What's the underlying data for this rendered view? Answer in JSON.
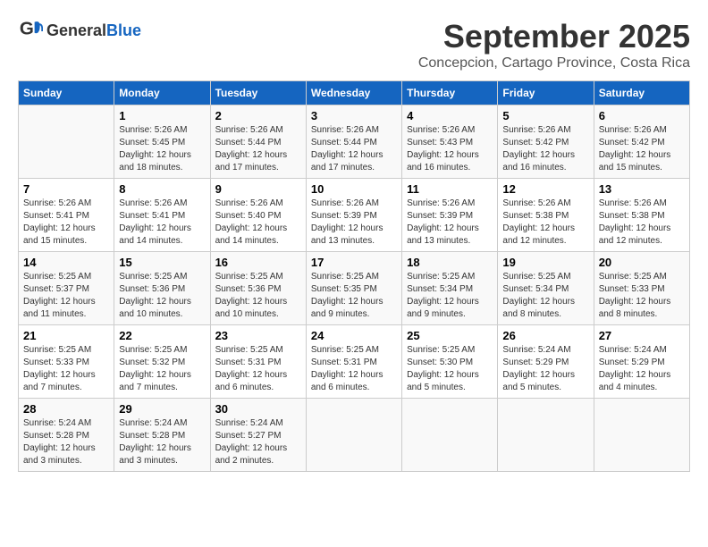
{
  "logo": {
    "general": "General",
    "blue": "Blue"
  },
  "title": "September 2025",
  "location": "Concepcion, Cartago Province, Costa Rica",
  "days_of_week": [
    "Sunday",
    "Monday",
    "Tuesday",
    "Wednesday",
    "Thursday",
    "Friday",
    "Saturday"
  ],
  "weeks": [
    [
      {
        "day": "",
        "info": ""
      },
      {
        "day": "1",
        "info": "Sunrise: 5:26 AM\nSunset: 5:45 PM\nDaylight: 12 hours\nand 18 minutes."
      },
      {
        "day": "2",
        "info": "Sunrise: 5:26 AM\nSunset: 5:44 PM\nDaylight: 12 hours\nand 17 minutes."
      },
      {
        "day": "3",
        "info": "Sunrise: 5:26 AM\nSunset: 5:44 PM\nDaylight: 12 hours\nand 17 minutes."
      },
      {
        "day": "4",
        "info": "Sunrise: 5:26 AM\nSunset: 5:43 PM\nDaylight: 12 hours\nand 16 minutes."
      },
      {
        "day": "5",
        "info": "Sunrise: 5:26 AM\nSunset: 5:42 PM\nDaylight: 12 hours\nand 16 minutes."
      },
      {
        "day": "6",
        "info": "Sunrise: 5:26 AM\nSunset: 5:42 PM\nDaylight: 12 hours\nand 15 minutes."
      }
    ],
    [
      {
        "day": "7",
        "info": "Sunrise: 5:26 AM\nSunset: 5:41 PM\nDaylight: 12 hours\nand 15 minutes."
      },
      {
        "day": "8",
        "info": "Sunrise: 5:26 AM\nSunset: 5:41 PM\nDaylight: 12 hours\nand 14 minutes."
      },
      {
        "day": "9",
        "info": "Sunrise: 5:26 AM\nSunset: 5:40 PM\nDaylight: 12 hours\nand 14 minutes."
      },
      {
        "day": "10",
        "info": "Sunrise: 5:26 AM\nSunset: 5:39 PM\nDaylight: 12 hours\nand 13 minutes."
      },
      {
        "day": "11",
        "info": "Sunrise: 5:26 AM\nSunset: 5:39 PM\nDaylight: 12 hours\nand 13 minutes."
      },
      {
        "day": "12",
        "info": "Sunrise: 5:26 AM\nSunset: 5:38 PM\nDaylight: 12 hours\nand 12 minutes."
      },
      {
        "day": "13",
        "info": "Sunrise: 5:26 AM\nSunset: 5:38 PM\nDaylight: 12 hours\nand 12 minutes."
      }
    ],
    [
      {
        "day": "14",
        "info": "Sunrise: 5:25 AM\nSunset: 5:37 PM\nDaylight: 12 hours\nand 11 minutes."
      },
      {
        "day": "15",
        "info": "Sunrise: 5:25 AM\nSunset: 5:36 PM\nDaylight: 12 hours\nand 10 minutes."
      },
      {
        "day": "16",
        "info": "Sunrise: 5:25 AM\nSunset: 5:36 PM\nDaylight: 12 hours\nand 10 minutes."
      },
      {
        "day": "17",
        "info": "Sunrise: 5:25 AM\nSunset: 5:35 PM\nDaylight: 12 hours\nand 9 minutes."
      },
      {
        "day": "18",
        "info": "Sunrise: 5:25 AM\nSunset: 5:34 PM\nDaylight: 12 hours\nand 9 minutes."
      },
      {
        "day": "19",
        "info": "Sunrise: 5:25 AM\nSunset: 5:34 PM\nDaylight: 12 hours\nand 8 minutes."
      },
      {
        "day": "20",
        "info": "Sunrise: 5:25 AM\nSunset: 5:33 PM\nDaylight: 12 hours\nand 8 minutes."
      }
    ],
    [
      {
        "day": "21",
        "info": "Sunrise: 5:25 AM\nSunset: 5:33 PM\nDaylight: 12 hours\nand 7 minutes."
      },
      {
        "day": "22",
        "info": "Sunrise: 5:25 AM\nSunset: 5:32 PM\nDaylight: 12 hours\nand 7 minutes."
      },
      {
        "day": "23",
        "info": "Sunrise: 5:25 AM\nSunset: 5:31 PM\nDaylight: 12 hours\nand 6 minutes."
      },
      {
        "day": "24",
        "info": "Sunrise: 5:25 AM\nSunset: 5:31 PM\nDaylight: 12 hours\nand 6 minutes."
      },
      {
        "day": "25",
        "info": "Sunrise: 5:25 AM\nSunset: 5:30 PM\nDaylight: 12 hours\nand 5 minutes."
      },
      {
        "day": "26",
        "info": "Sunrise: 5:24 AM\nSunset: 5:29 PM\nDaylight: 12 hours\nand 5 minutes."
      },
      {
        "day": "27",
        "info": "Sunrise: 5:24 AM\nSunset: 5:29 PM\nDaylight: 12 hours\nand 4 minutes."
      }
    ],
    [
      {
        "day": "28",
        "info": "Sunrise: 5:24 AM\nSunset: 5:28 PM\nDaylight: 12 hours\nand 3 minutes."
      },
      {
        "day": "29",
        "info": "Sunrise: 5:24 AM\nSunset: 5:28 PM\nDaylight: 12 hours\nand 3 minutes."
      },
      {
        "day": "30",
        "info": "Sunrise: 5:24 AM\nSunset: 5:27 PM\nDaylight: 12 hours\nand 2 minutes."
      },
      {
        "day": "",
        "info": ""
      },
      {
        "day": "",
        "info": ""
      },
      {
        "day": "",
        "info": ""
      },
      {
        "day": "",
        "info": ""
      }
    ]
  ]
}
